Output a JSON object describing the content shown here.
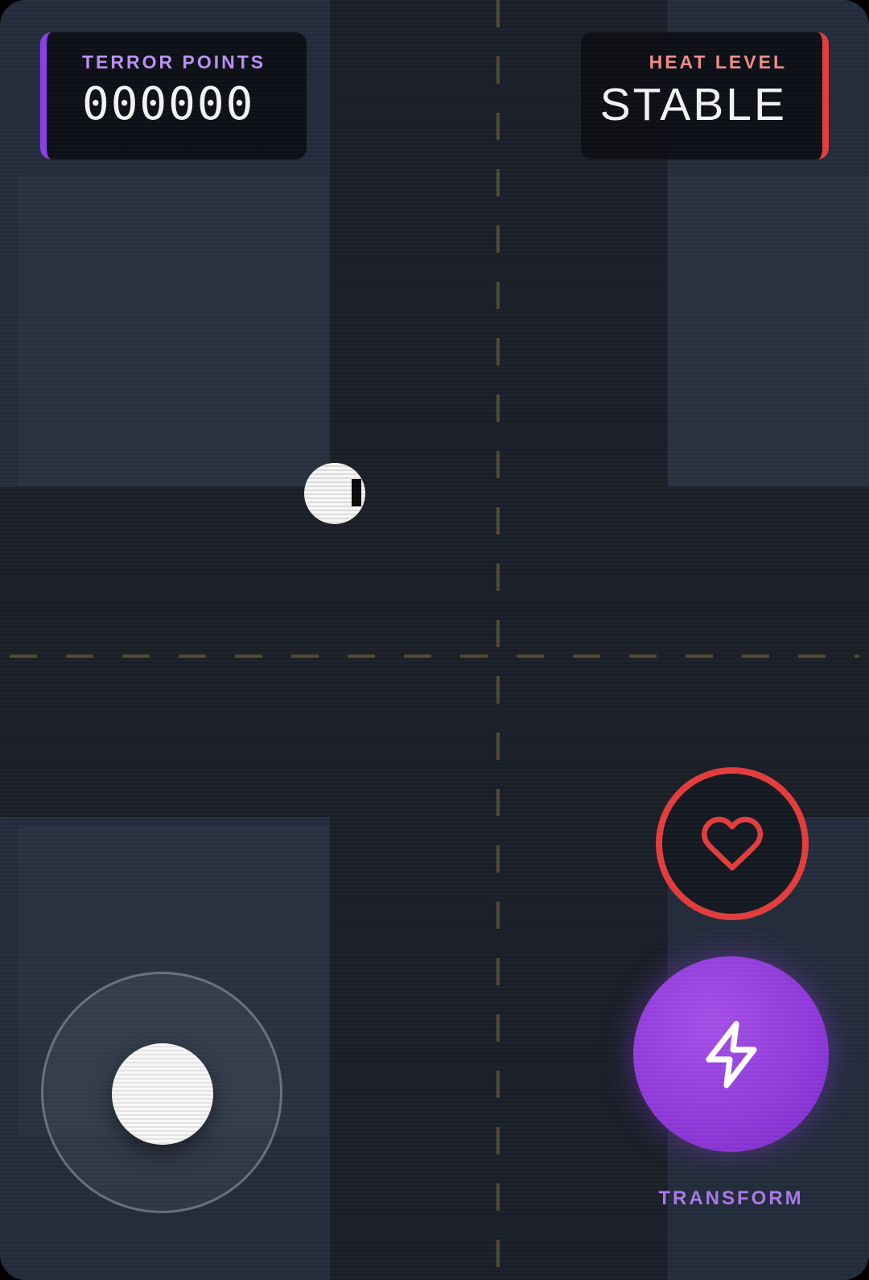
{
  "hud": {
    "score_label": "TERROR POINTS",
    "score_value": "000000",
    "heat_label": "HEAT LEVEL",
    "heat_value": "STABLE"
  },
  "controls": {
    "heart_icon": "heart-icon",
    "transform_icon": "lightning-bolt-icon",
    "transform_label": "TRANSFORM"
  },
  "colors": {
    "accent_purple": "#8a3ee6",
    "accent_red": "#e23c3c",
    "road": "#1a1f28",
    "block": "#232c3a",
    "lane_marking": "#5a5034"
  }
}
